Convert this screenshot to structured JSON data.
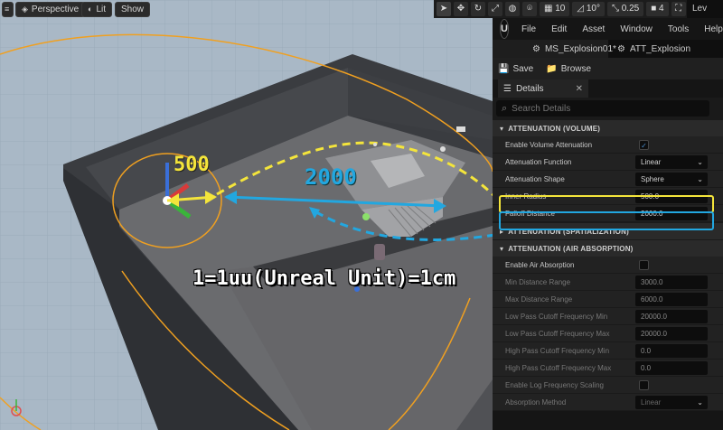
{
  "viewport": {
    "perspective_label": "Perspective",
    "lit_label": "Lit",
    "show_label": "Show",
    "grid_snap_value": "10",
    "rotation_snap_value": "10°",
    "scale_snap_value": "0.25",
    "camera_speed_value": "4",
    "annotations": {
      "inner_radius_value": "500",
      "falloff_value": "2000",
      "unit_note": "1=1uu(Unreal Unit)=1cm"
    },
    "colors": {
      "yellow": "#f4e53b",
      "blue": "#22a7e0",
      "orange": "#f0a020"
    }
  },
  "editor": {
    "level_tab": "Lev",
    "menu": [
      "File",
      "Edit",
      "Asset",
      "Window",
      "Tools",
      "Help"
    ],
    "tabs": [
      {
        "label": "MS_Explosion01*",
        "active": true
      },
      {
        "label": "ATT_Explosion",
        "active": false
      }
    ],
    "toolbar": {
      "save_label": "Save",
      "browse_label": "Browse"
    },
    "details_tab": "Details",
    "search_placeholder": "Search Details",
    "sections": {
      "volume": "ATTENUATION (VOLUME)",
      "spatialization": "ATTENUATION (SPATIALIZATION)",
      "air": "ATTENUATION (AIR ABSORPTION)"
    },
    "props": {
      "enable_volume": {
        "label": "Enable Volume Attenuation",
        "checked": "✓"
      },
      "function": {
        "label": "Attenuation Function",
        "value": "Linear"
      },
      "shape": {
        "label": "Attenuation Shape",
        "value": "Sphere"
      },
      "inner_radius": {
        "label": "Inner Radius",
        "value": "500.0"
      },
      "falloff": {
        "label": "Falloff Distance",
        "value": "2000.0"
      },
      "enable_air": {
        "label": "Enable Air Absorption"
      },
      "min_dist": {
        "label": "Min Distance Range",
        "value": "3000.0"
      },
      "max_dist": {
        "label": "Max Distance Range",
        "value": "6000.0"
      },
      "lp_min": {
        "label": "Low Pass Cutoff Frequency Min",
        "value": "20000.0"
      },
      "lp_max": {
        "label": "Low Pass Cutoff Frequency Max",
        "value": "20000.0"
      },
      "hp_min": {
        "label": "High Pass Cutoff Frequency Min",
        "value": "0.0"
      },
      "hp_max": {
        "label": "High Pass Cutoff Frequency Max",
        "value": "0.0"
      },
      "log_freq": {
        "label": "Enable Log Frequency Scaling"
      },
      "abs_method": {
        "label": "Absorption Method",
        "value": "Linear"
      }
    }
  }
}
